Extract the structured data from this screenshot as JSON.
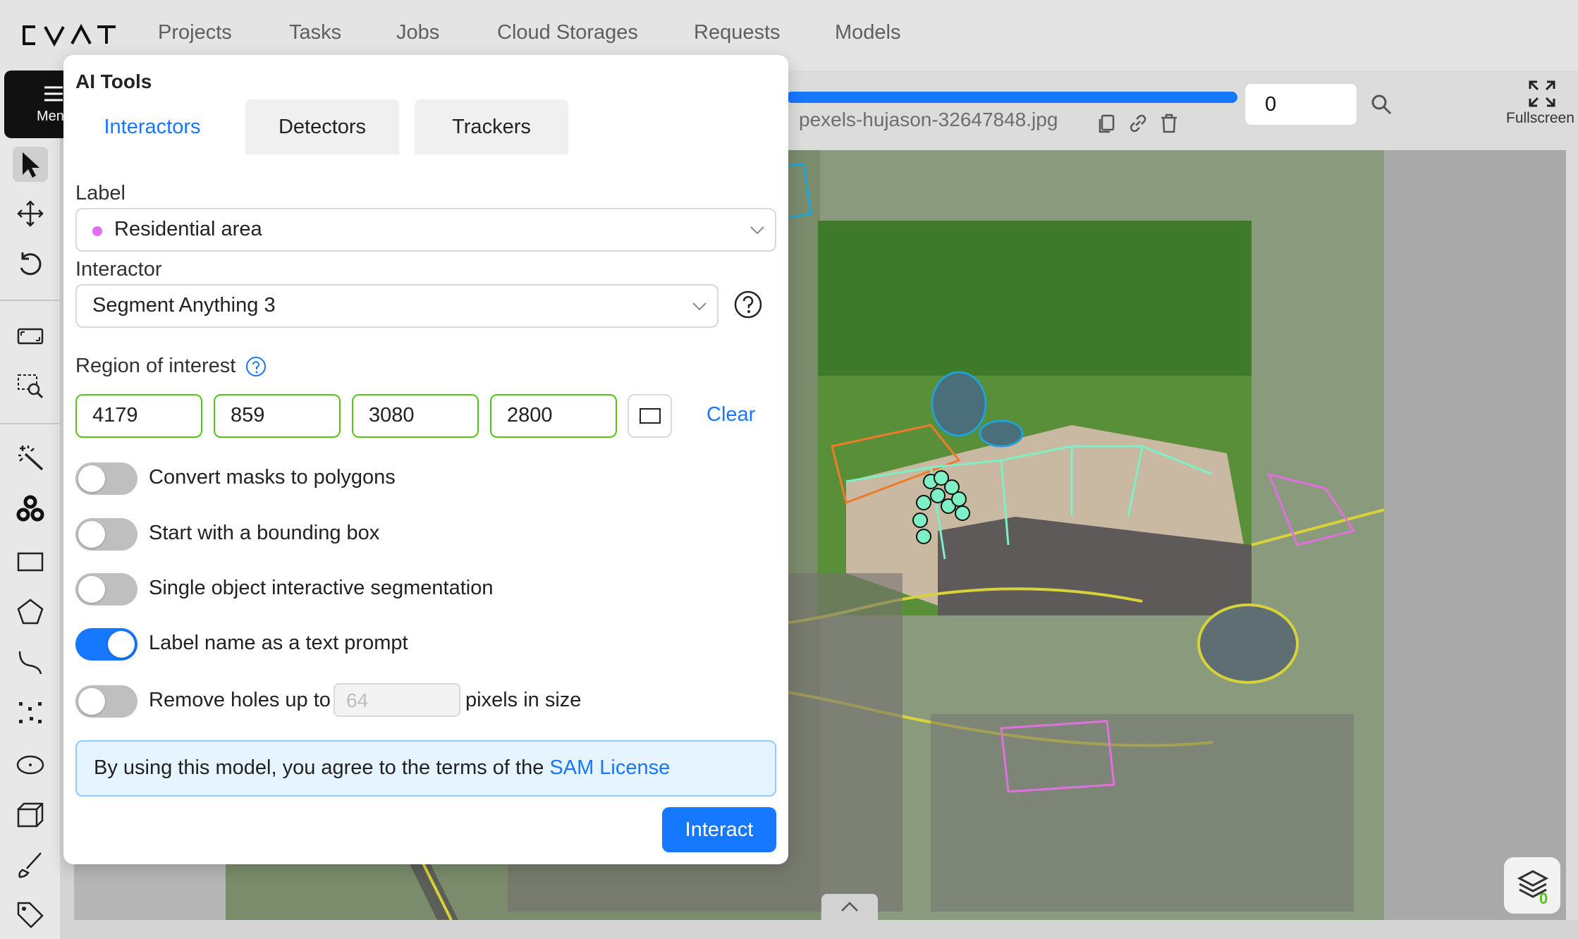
{
  "app": {
    "logo_text": "CVAT",
    "nav": [
      "Projects",
      "Tasks",
      "Jobs",
      "Cloud Storages",
      "Requests",
      "Models"
    ]
  },
  "toolbar": {
    "menu_label": "Menu",
    "tools": [
      "cursor-icon",
      "move-icon",
      "rotate-icon",
      "fit-image-icon",
      "zoom-region-icon",
      "magic-wand-icon",
      "opencv-icon",
      "rectangle-icon",
      "polygon-icon",
      "polyline-icon",
      "points-icon",
      "ellipse-icon",
      "cuboid-icon",
      "brush-icon",
      "tag-icon"
    ]
  },
  "player": {
    "frame_number": "0",
    "filename": "pexels-hujason-32647848.jpg",
    "fullscreen_label": "Fullscreen",
    "progress": 1.0,
    "layers_count": "0"
  },
  "panel": {
    "title": "AI Tools",
    "tabs": [
      "Interactors",
      "Detectors",
      "Trackers"
    ],
    "active_tab": "Interactors",
    "label_field": "Label",
    "label_value": "Residential area",
    "label_color": "#e26ff0",
    "interactor_field": "Interactor",
    "interactor_value": "Segment Anything 3",
    "roi_label": "Region of interest",
    "roi": [
      "4179",
      "859",
      "3080",
      "2800"
    ],
    "clear_label": "Clear",
    "toggles": [
      {
        "label": "Convert masks to polygons",
        "on": false
      },
      {
        "label": "Start with a bounding box",
        "on": false
      },
      {
        "label": "Single object interactive segmentation",
        "on": false
      },
      {
        "label": "Label name as a text prompt",
        "on": true
      }
    ],
    "remove_holes": {
      "prefix": "Remove holes up to",
      "placeholder": "64",
      "suffix": "pixels in size",
      "on": false
    },
    "license_text": "By using this model, you agree to the terms of the",
    "license_link": "SAM License",
    "interact_label": "Interact"
  }
}
